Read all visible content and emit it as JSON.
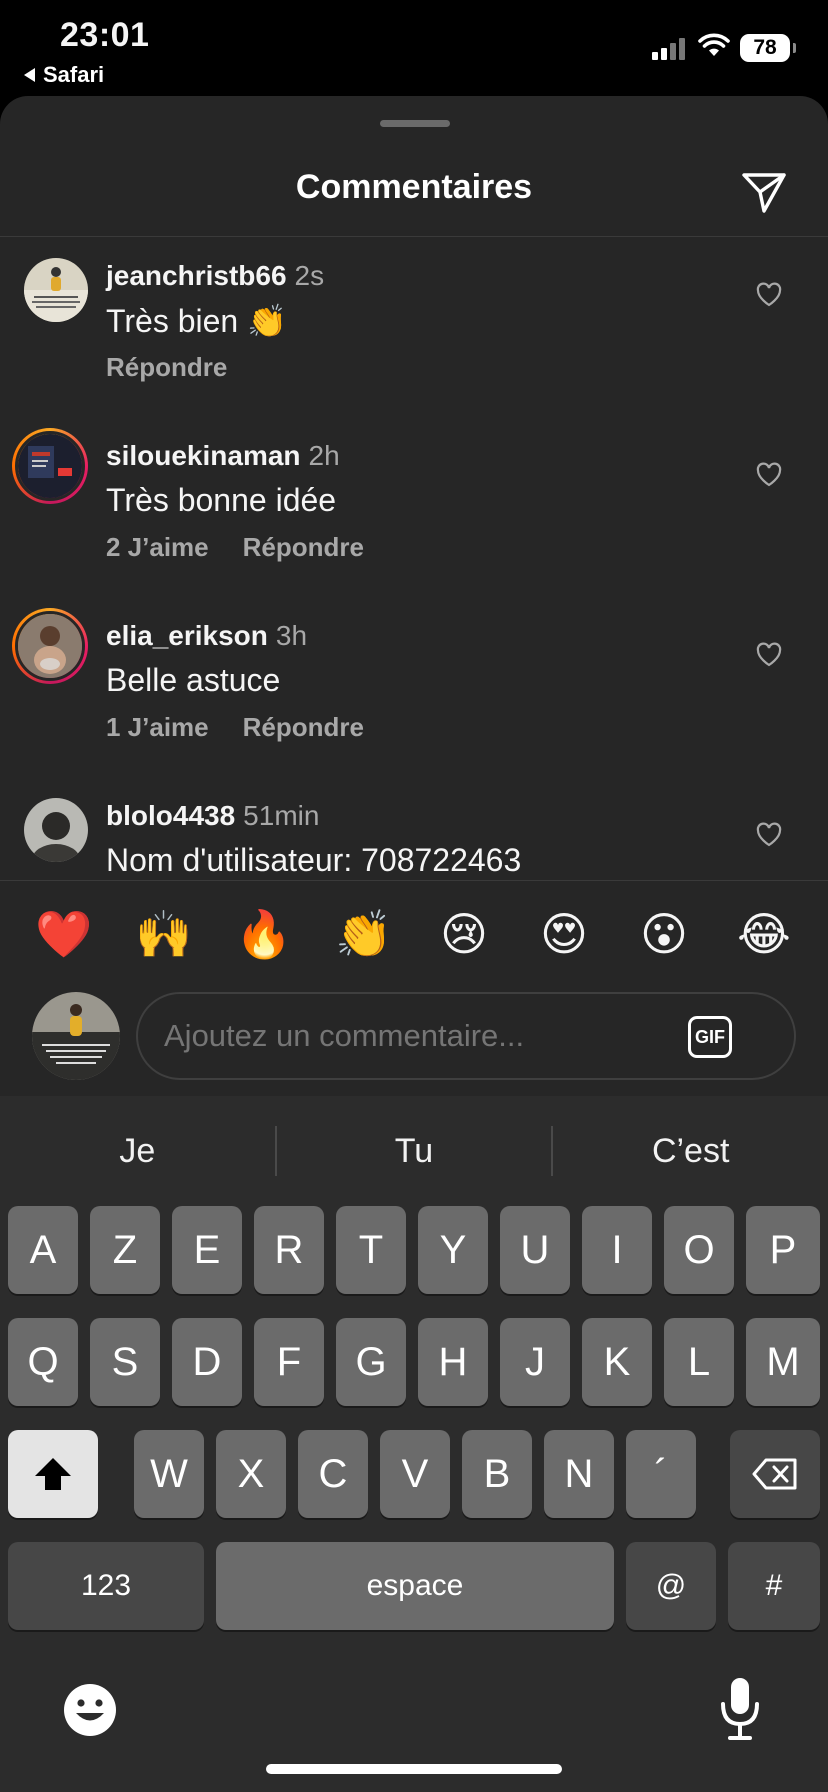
{
  "status_bar": {
    "time": "23:01",
    "back_app": "Safari",
    "battery": "78"
  },
  "sheet": {
    "title": "Commentaires"
  },
  "comments": [
    {
      "username": "jeanchristb66",
      "time": "2s",
      "text": "Très bien 👏",
      "likes": "",
      "reply": "Répondre"
    },
    {
      "username": "silouekinaman",
      "time": "2h",
      "text": "Très bonne idée",
      "likes": "2 J’aime",
      "reply": "Répondre"
    },
    {
      "username": "elia_erikson",
      "time": "3h",
      "text": "Belle astuce",
      "likes": "1 J’aime",
      "reply": "Répondre"
    },
    {
      "username": "blolo4438",
      "time": "51min",
      "text": "Nom d'utilisateur: 708722463",
      "likes": "",
      "reply": ""
    }
  ],
  "reactions": [
    "❤️",
    "🙌",
    "🔥",
    "👏",
    "😢",
    "😍",
    "😮",
    "😂"
  ],
  "composer": {
    "placeholder": "Ajoutez un commentaire...",
    "gif_label": "GIF"
  },
  "keyboard": {
    "suggestions": [
      "Je",
      "Tu",
      "C’est"
    ],
    "row1": [
      "A",
      "Z",
      "E",
      "R",
      "T",
      "Y",
      "U",
      "I",
      "O",
      "P"
    ],
    "row2": [
      "Q",
      "S",
      "D",
      "F",
      "G",
      "H",
      "J",
      "K",
      "L",
      "M"
    ],
    "row3": [
      "W",
      "X",
      "C",
      "V",
      "B",
      "N",
      "´"
    ],
    "numbers_label": "123",
    "space_label": "espace",
    "at_label": "@",
    "hash_label": "#"
  },
  "colors": {
    "sheet_bg": "#262626",
    "key_bg": "#6b6b6b",
    "key_dark": "#474747",
    "secondary_text": "#a8a8a8"
  }
}
